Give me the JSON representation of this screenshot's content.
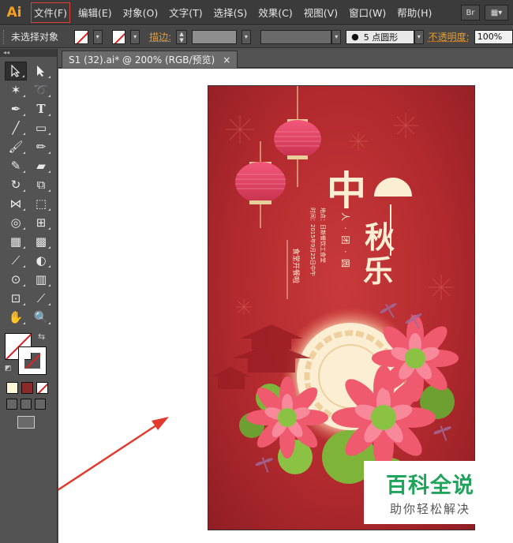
{
  "app": {
    "logo": "Ai"
  },
  "menu": {
    "items": [
      "文件(F)",
      "编辑(E)",
      "对象(O)",
      "文字(T)",
      "选择(S)",
      "效果(C)",
      "视图(V)",
      "窗口(W)",
      "帮助(H)"
    ],
    "highlighted_index": 0,
    "right_buttons": [
      "Br",
      "▦▾"
    ]
  },
  "control_bar": {
    "selection_status": "未选择对象",
    "stroke_label": "描边:",
    "brush_profile": "5 点圆形",
    "opacity_label": "不透明度:",
    "opacity_value": "100%"
  },
  "tools_panel": {
    "collapse_glyph": "◂◂"
  },
  "document_tab": {
    "title": "S1 (32).ai* @ 200% (RGB/预览)",
    "close_glyph": "×"
  },
  "poster": {
    "title_chars": [
      "中",
      "秋",
      "乐"
    ],
    "subtitle": "人 · 团 · 圆",
    "info_line_1": "时间：2015年9月25日中午",
    "info_line_2": "地点：日新餐饮工食堂",
    "badge": "食堂开餐啦"
  },
  "watermark": {
    "title": "百科全说",
    "subtitle": "助你轻松解决"
  },
  "colors": {
    "poster_red": "#b22a2e",
    "lantern_pink": "#e0456a",
    "moon_cream": "#fbeed3",
    "lotus_pink": "#ef5a6f",
    "leaf_green": "#7fb43a",
    "watermark_green": "#20a35b",
    "arrow_red": "#e23b2e",
    "ai_orange": "#f7a01d"
  }
}
